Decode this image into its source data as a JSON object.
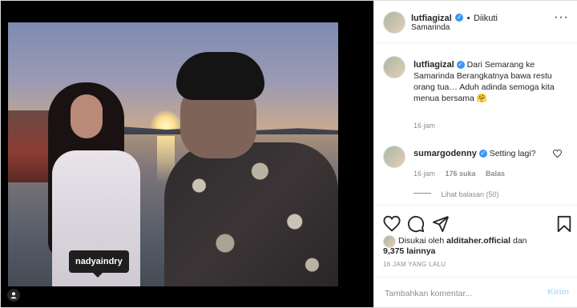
{
  "post": {
    "author": "lutfiagizal",
    "follow_separator": "•",
    "follow_state": "Diikuti",
    "location": "Samarinda",
    "photo_tag": "nadyaindry"
  },
  "caption": {
    "author": "lutfiagizal",
    "text": "Dari Semarang ke Samarinda Berangkatnya bawa restu orang tua… Aduh adinda semoga kita menua bersama 🤗",
    "time": "16 jam"
  },
  "comments": [
    {
      "author": "sumargodenny",
      "text": "Setting lagi?",
      "time": "16 jam",
      "likes": "176 suka",
      "reply": "Balas",
      "view_replies": "Lihat balasan (50)"
    }
  ],
  "likes": {
    "prefix": "Disukai oleh",
    "user": "alditaher.official",
    "suffix": "dan",
    "others": "9,375 lainnya"
  },
  "timestamp": "16 JAM YANG LALU",
  "composer": {
    "placeholder": "Tambahkan komentar...",
    "send_label": "Kirim"
  },
  "colors": {
    "verified": "#3897f0",
    "send": "#b2dffc",
    "muted": "#8e8e8e"
  },
  "icons": [
    "user-tag-icon",
    "verified-icon",
    "more-icon",
    "heart-icon",
    "comment-icon",
    "share-icon",
    "bookmark-icon"
  ]
}
